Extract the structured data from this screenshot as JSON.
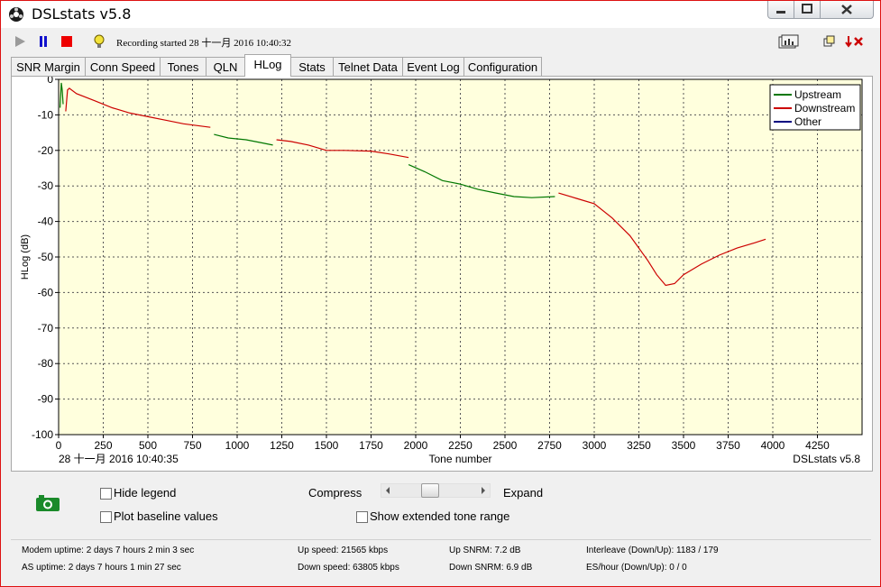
{
  "window": {
    "title": "DSLstats v5.8"
  },
  "toolbar": {
    "recording_text": "Recording started 28 十一月 2016 10:40:32"
  },
  "tabs": [
    {
      "label": "SNR Margin"
    },
    {
      "label": "Conn Speed"
    },
    {
      "label": "Tones"
    },
    {
      "label": "QLN"
    },
    {
      "label": "HLog",
      "active": true
    },
    {
      "label": "Stats"
    },
    {
      "label": "Telnet Data"
    },
    {
      "label": "Event Log"
    },
    {
      "label": "Configuration"
    }
  ],
  "chart_data": {
    "type": "line",
    "xlabel": "Tone number",
    "ylabel": "HLog (dB)",
    "timestamp": "28 十一月 2016 10:40:35",
    "watermark": "DSLstats v5.8",
    "xlim": [
      0,
      4500
    ],
    "ylim": [
      -100,
      0
    ],
    "x_ticks": [
      0,
      250,
      500,
      750,
      1000,
      1250,
      1500,
      1750,
      2000,
      2250,
      2500,
      2750,
      3000,
      3250,
      3500,
      3750,
      4000,
      4250
    ],
    "y_ticks": [
      0,
      -10,
      -20,
      -30,
      -40,
      -50,
      -60,
      -70,
      -80,
      -90,
      -100
    ],
    "grid": true,
    "background": "#ffffdd",
    "legend_position": "top-right",
    "series": [
      {
        "name": "Upstream",
        "color": "#007700",
        "segments": [
          [
            [
              8,
              -8
            ],
            [
              15,
              -1
            ],
            [
              20,
              -3
            ],
            [
              25,
              -7
            ]
          ],
          [
            [
              870,
              -15.5
            ],
            [
              950,
              -16.5
            ],
            [
              1050,
              -17
            ],
            [
              1150,
              -18
            ],
            [
              1200,
              -18.5
            ]
          ],
          [
            [
              1960,
              -24
            ],
            [
              2050,
              -26
            ],
            [
              2150,
              -28.5
            ],
            [
              2250,
              -29.5
            ],
            [
              2350,
              -31
            ],
            [
              2450,
              -32
            ],
            [
              2550,
              -33
            ],
            [
              2650,
              -33.3
            ],
            [
              2780,
              -33
            ]
          ]
        ]
      },
      {
        "name": "Downstream",
        "color": "#cc0000",
        "segments": [
          [
            [
              40,
              -9
            ],
            [
              50,
              -3
            ],
            [
              60,
              -2.5
            ],
            [
              100,
              -4
            ],
            [
              200,
              -6
            ],
            [
              300,
              -8
            ],
            [
              400,
              -9.5
            ],
            [
              500,
              -10.5
            ],
            [
              600,
              -11.5
            ],
            [
              700,
              -12.5
            ],
            [
              850,
              -13.5
            ]
          ],
          [
            [
              1220,
              -17
            ],
            [
              1300,
              -17.5
            ],
            [
              1400,
              -18.5
            ],
            [
              1500,
              -20
            ],
            [
              1600,
              -20
            ],
            [
              1750,
              -20.2
            ],
            [
              1850,
              -21
            ],
            [
              1960,
              -22
            ]
          ],
          [
            [
              2800,
              -32
            ],
            [
              2900,
              -33.5
            ],
            [
              3000,
              -35
            ],
            [
              3100,
              -39
            ],
            [
              3200,
              -44
            ],
            [
              3300,
              -51
            ],
            [
              3350,
              -55
            ],
            [
              3400,
              -58
            ],
            [
              3450,
              -57.5
            ],
            [
              3500,
              -55
            ],
            [
              3600,
              -52
            ],
            [
              3700,
              -49.5
            ],
            [
              3800,
              -47.5
            ],
            [
              3900,
              -46
            ],
            [
              3960,
              -45
            ]
          ]
        ]
      },
      {
        "name": "Other",
        "color": "#000080",
        "segments": []
      }
    ]
  },
  "controls": {
    "hide_legend": "Hide legend",
    "plot_baseline": "Plot baseline values",
    "compress": "Compress",
    "expand": "Expand",
    "show_extended": "Show extended tone range"
  },
  "status": {
    "modem_uptime": "Modem uptime: 2 days 7 hours 2 min 3 sec",
    "as_uptime": "AS uptime: 2 days 7 hours 1 min 27 sec",
    "up_speed": "Up speed: 21565 kbps",
    "down_speed": "Down speed: 63805 kbps",
    "up_snrm": "Up SNRM: 7.2 dB",
    "down_snrm": "Down SNRM: 6.9 dB",
    "interleave": "Interleave (Down/Up): 1183 / 179",
    "es_hour": "ES/hour (Down/Up): 0 / 0"
  }
}
